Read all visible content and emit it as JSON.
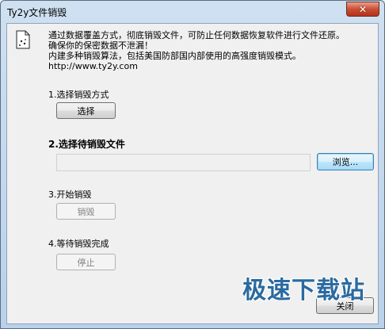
{
  "window": {
    "title": "Ty2y文件销毁",
    "close_glyph": "✕"
  },
  "intro": {
    "lines": [
      "通过数据覆盖方式，彻底销毁文件，可防止任何数据恢复软件进行文件还原。",
      "确保你的保密数据不泄漏！",
      "内建多种销毁算法，包括美国防部国内部使用的高强度销毁模式。",
      "http://www.ty2y.com"
    ]
  },
  "step1": {
    "label": "1.选择销毁方式",
    "button": "选择"
  },
  "step2": {
    "label": "2.选择待销毁文件",
    "path_value": "",
    "browse_button": "浏览..."
  },
  "step3": {
    "label": "3.开始销毁",
    "button": "销毁"
  },
  "step4": {
    "label": "4.等待销毁完成",
    "button": "停止"
  },
  "footer": {
    "close_button": "关闭"
  },
  "watermark": {
    "text": "极速下载站"
  }
}
